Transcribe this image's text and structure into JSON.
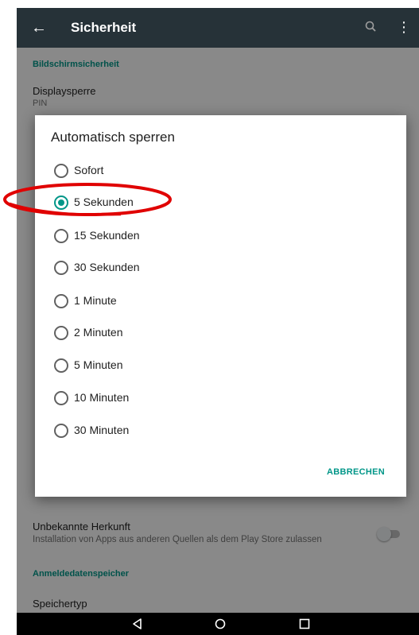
{
  "appbar": {
    "title": "Sicherheit"
  },
  "background": {
    "section_screen": "Bildschirmsicherheit",
    "display_lock_title": "Displaysperre",
    "display_lock_value": "PIN",
    "unknown_sources_title": "Unbekannte Herkunft",
    "unknown_sources_desc": "Installation von Apps aus anderen Quellen als dem Play Store zulassen",
    "unknown_sources_enabled": false,
    "section_credentials": "Anmeldedatenspeicher",
    "storage_type_title": "Speichertyp"
  },
  "dialog": {
    "title": "Automatisch sperren",
    "selected_index": 1,
    "options": [
      {
        "label": "Sofort"
      },
      {
        "label": "5 Sekunden"
      },
      {
        "label": "15 Sekunden"
      },
      {
        "label": "30 Sekunden"
      },
      {
        "label": "1 Minute"
      },
      {
        "label": "2 Minuten"
      },
      {
        "label": "5 Minuten"
      },
      {
        "label": "10 Minuten"
      },
      {
        "label": "30 Minuten"
      }
    ],
    "cancel_label": "ABBRECHEN"
  },
  "icons": {
    "back": "arrow-back-icon",
    "search": "search-icon",
    "more": "more-vert-icon",
    "nav_back": "nav-back-icon",
    "nav_home": "nav-home-icon",
    "nav_recents": "nav-recents-icon"
  },
  "colors": {
    "accent": "#009688",
    "appbar": "#263238",
    "annotation": "#e00000"
  }
}
